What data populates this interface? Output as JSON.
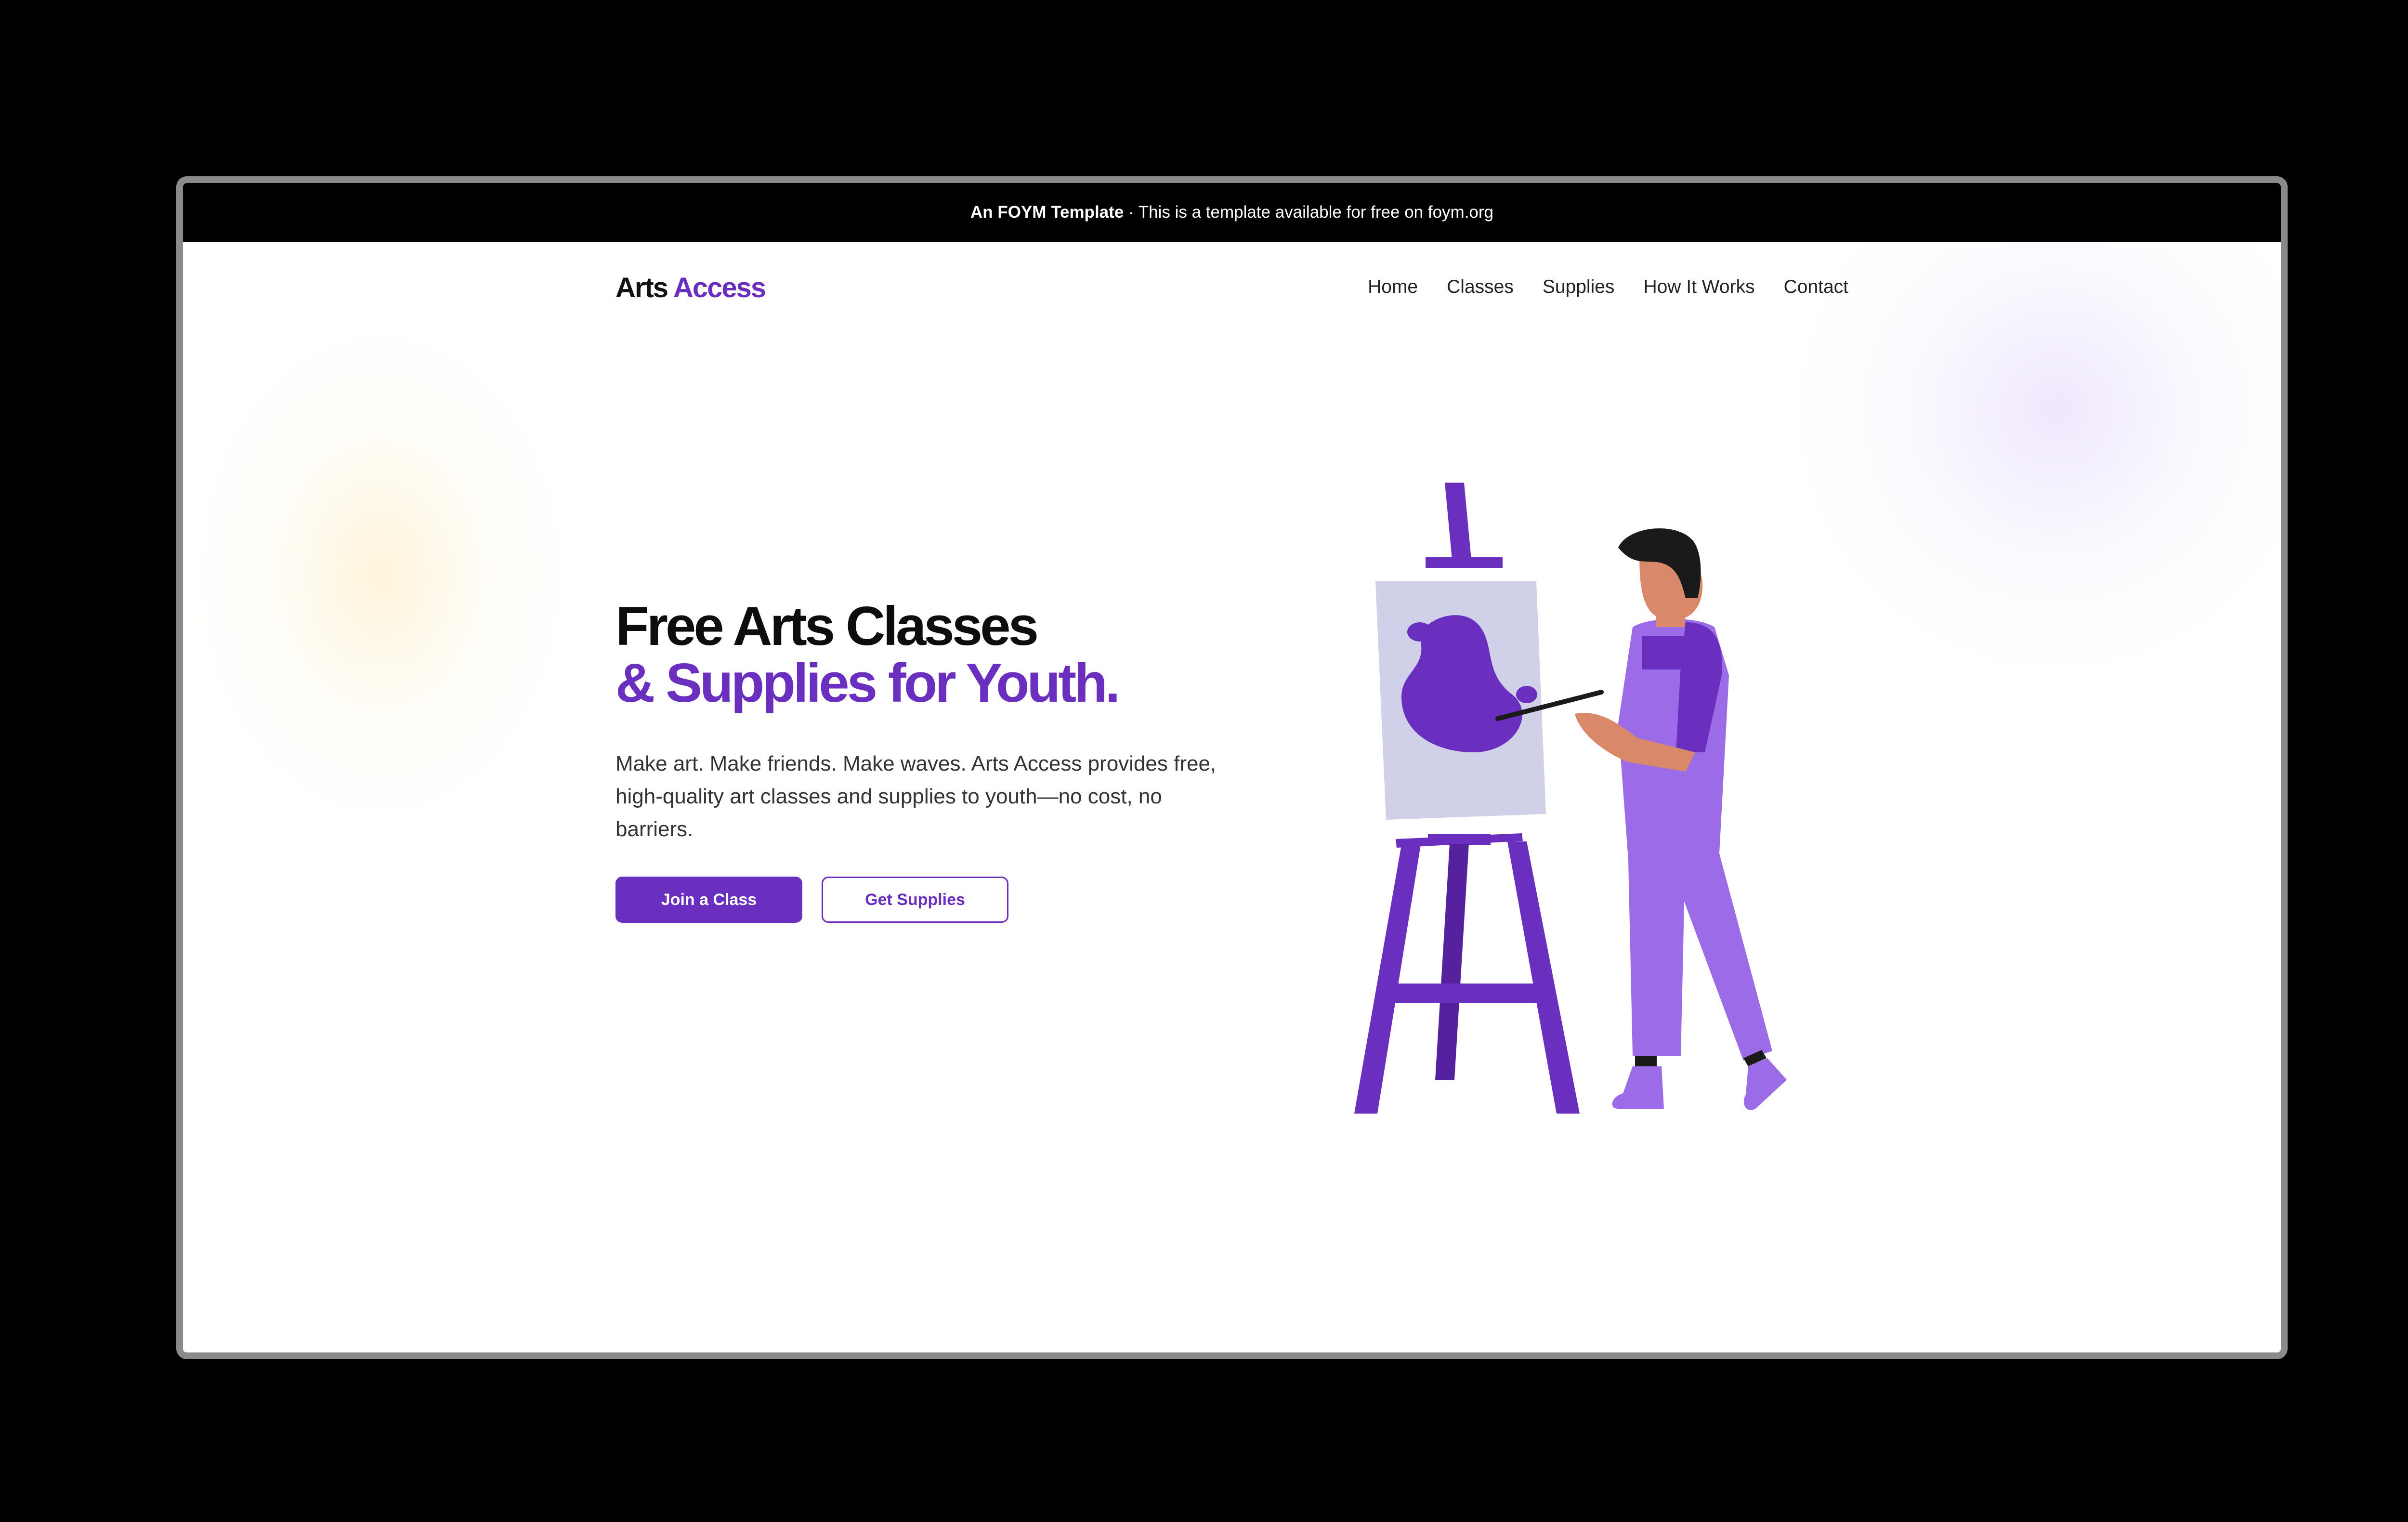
{
  "banner": {
    "strong": "An FOYM Template",
    "text": " · This is a template available for free on foym.org"
  },
  "logo": {
    "part1": "Arts",
    "part2": "Access"
  },
  "nav": {
    "items": [
      "Home",
      "Classes",
      "Supplies",
      "How It Works",
      "Contact"
    ]
  },
  "hero": {
    "headline_line1": "Free Arts Classes",
    "headline_line2": "& Supplies for Youth.",
    "lead": "Make art. Make friends. Make waves. Arts Access provides free, high-quality art classes and supplies to youth—no cost, no barriers.",
    "primary_button": "Join a Class",
    "secondary_button": "Get Supplies"
  },
  "colors": {
    "brand_purple": "#6b2fc0",
    "light_purple": "#9b6be8",
    "banner_bg": "#000000"
  },
  "icons": [
    "painter-illustration",
    "easel-icon",
    "canvas-icon"
  ]
}
